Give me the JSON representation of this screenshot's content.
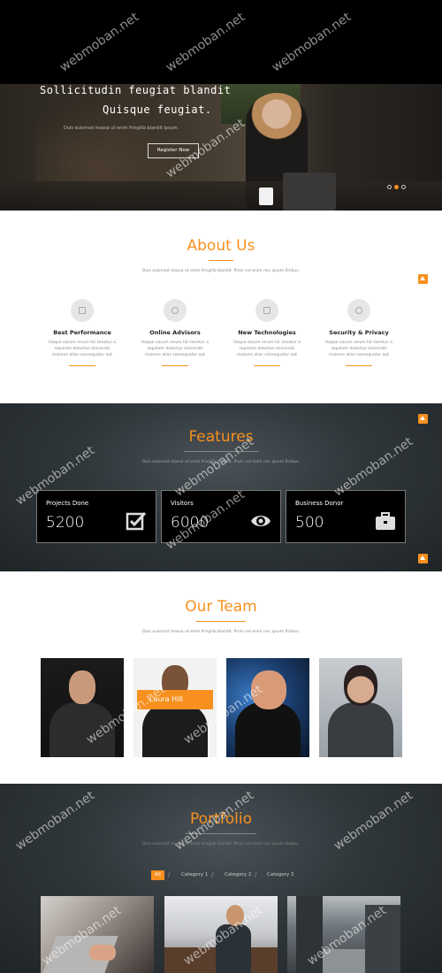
{
  "hero": {
    "title_line1": "Sollicitudin feugiat blandit",
    "title_line2": "Quisque feugiat.",
    "subtitle": "Duis euismod massa ut enim fringilla blandit ipsum.",
    "button_label": "Register Now",
    "slides": 3,
    "active_slide": 2
  },
  "about": {
    "title": "About Us",
    "subtitle": "Duis euismod massa ut enim fringilla blandit. Proin vel enim nec ipsum finibus.",
    "services": [
      {
        "title": "Best Performance",
        "desc": "Itaque earum rerum hic tenetur a sapiente delectus reiciendis maiores alias consequatur aut",
        "icon": "bar-chart-icon"
      },
      {
        "title": "Online Advisors",
        "desc": "Itaque earum rerum hic tenetur a sapiente delectus reiciendis maiores alias consequatur aut",
        "icon": "user-icon"
      },
      {
        "title": "New Technologies",
        "desc": "Itaque earum rerum hic tenetur a sapiente delectus reiciendis maiores alias consequatur aut",
        "icon": "newspaper-icon"
      },
      {
        "title": "Security & Privacy",
        "desc": "Itaque earum rerum hic tenetur a sapiente delectus reiciendis maiores alias consequatur aut",
        "icon": "shield-check-icon"
      }
    ]
  },
  "features": {
    "title": "Features",
    "subtitle": "Duis euismod massa ut enim fringilla blandit. Proin vel enim nec ipsum finibus.",
    "stats": [
      {
        "label": "Projects Done",
        "value": "5200",
        "icon": "checkbox-icon"
      },
      {
        "label": "Visitors",
        "value": "6000",
        "icon": "eye-icon"
      },
      {
        "label": "Business Donor",
        "value": "500",
        "icon": "briefcase-icon"
      }
    ]
  },
  "team": {
    "title": "Our Team",
    "subtitle": "Duis euismod massa ut enim fringilla blandit. Proin vel enim nec ipsum finibus.",
    "highlight_name": "Laura Hill"
  },
  "portfolio": {
    "title": "Portfolio",
    "subtitle": "Duis euismod massa ut enim fringilla blandit. Proin vel enim nec ipsum finibus.",
    "filters": [
      "All",
      "Category 1",
      "Category 2",
      "Category 3"
    ]
  },
  "watermark": "webmoban.net",
  "colors": {
    "accent": "#f7901e",
    "dark": "#2c3235"
  }
}
